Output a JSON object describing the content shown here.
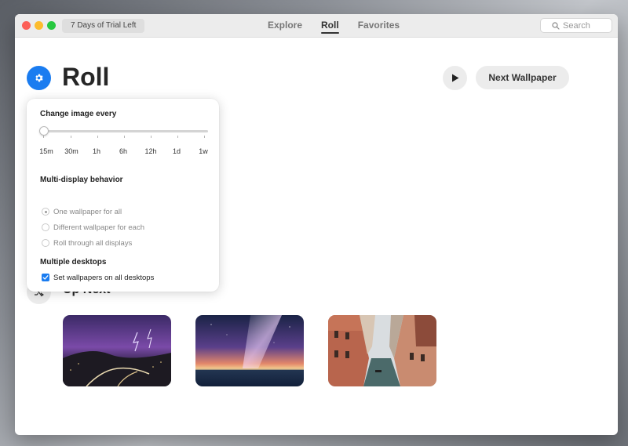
{
  "window": {
    "trial_badge": "7 Days of Trial Left",
    "tabs": [
      {
        "label": "Explore"
      },
      {
        "label": "Roll"
      },
      {
        "label": "Favorites"
      }
    ],
    "active_tab": "Roll",
    "search": {
      "placeholder": "Search",
      "value": ""
    }
  },
  "header": {
    "title": "Roll",
    "next_wallpaper_label": "Next Wallpaper"
  },
  "popover": {
    "change_image_label": "Change image every",
    "interval_options": [
      "15m",
      "30m",
      "1h",
      "6h",
      "12h",
      "1d",
      "1w"
    ],
    "interval_selected": "15m",
    "multi_display_label": "Multi-display behavior",
    "display_options": [
      {
        "label": "One wallpaper for all",
        "checked": true
      },
      {
        "label": "Different wallpaper for each",
        "checked": false
      },
      {
        "label": "Roll through all displays",
        "checked": false
      }
    ],
    "multiple_desktops_label": "Multiple desktops",
    "set_all_desktops_label": "Set wallpapers on all desktops",
    "set_all_desktops_checked": true
  },
  "up_next": {
    "title": "Up Next"
  },
  "colors": {
    "accent": "#1a7cf0",
    "close": "#fc5f57",
    "minimize": "#fdbc2e",
    "zoom": "#28c840"
  }
}
